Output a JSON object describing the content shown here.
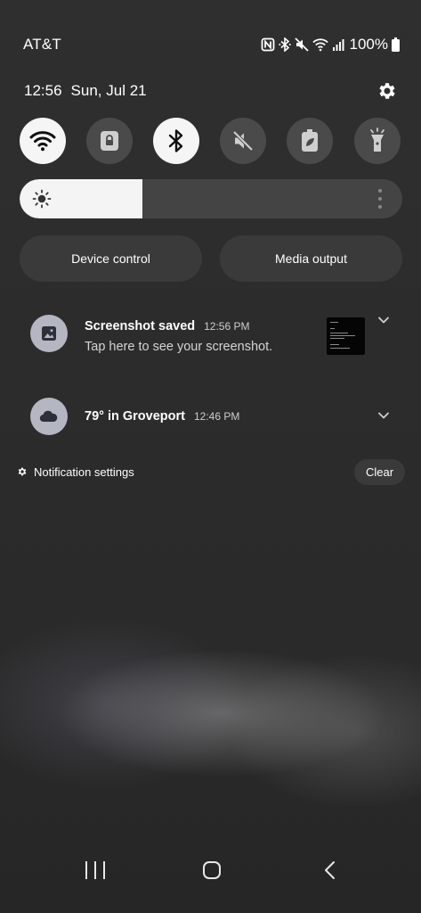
{
  "status_bar": {
    "carrier": "AT&T",
    "battery_percent": "100%",
    "icons": [
      "nfc-icon",
      "bluetooth-icon",
      "mute-icon",
      "wifi-icon",
      "signal-icon",
      "battery-icon"
    ]
  },
  "header": {
    "time": "12:56",
    "date": "Sun, Jul 21",
    "settings_icon": "gear-icon"
  },
  "quick_toggles": [
    {
      "name": "Wi-Fi",
      "icon": "wifi-icon",
      "state": "on"
    },
    {
      "name": "Secure Folder",
      "icon": "lock-icon",
      "state": "off"
    },
    {
      "name": "Bluetooth",
      "icon": "bluetooth-icon",
      "state": "on"
    },
    {
      "name": "Sound",
      "icon": "mute-icon",
      "state": "off"
    },
    {
      "name": "Power saving",
      "icon": "battery-leaf-icon",
      "state": "off"
    },
    {
      "name": "Flashlight",
      "icon": "flashlight-icon",
      "state": "off"
    }
  ],
  "brightness": {
    "level": 0.32
  },
  "buttons": {
    "device_control": "Device control",
    "media_output": "Media output"
  },
  "notifications": [
    {
      "title": "Screenshot saved",
      "time": "12:56 PM",
      "text": "Tap here to see your screenshot.",
      "icon": "image-icon"
    },
    {
      "title": "79° in Groveport",
      "time": "12:46 PM",
      "icon": "cloud-icon"
    }
  ],
  "footer": {
    "notification_settings": "Notification settings",
    "clear": "Clear"
  },
  "colors": {
    "toggle_on": "#f5f5f5",
    "toggle_off": "#4a4a4a",
    "pill_bg": "#3a3a3a",
    "notif_icon_bg": "#b4b6c2"
  }
}
